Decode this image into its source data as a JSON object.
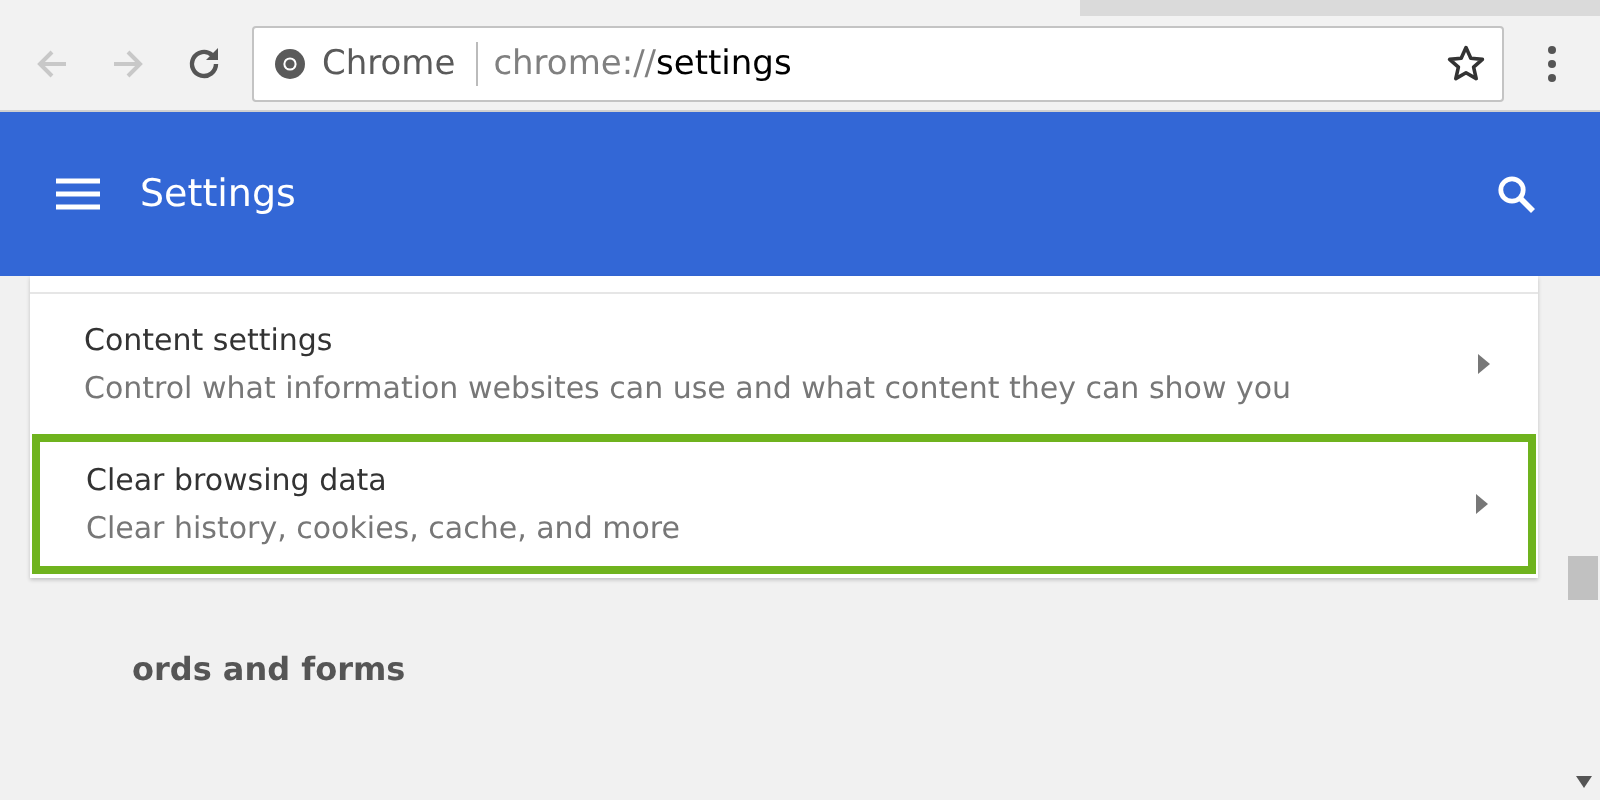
{
  "toolbar": {
    "back": {
      "disabled": true
    },
    "forward": {
      "disabled": true
    },
    "address": {
      "site_label": "Chrome",
      "url_scheme": "chrome://",
      "url_path": "settings"
    }
  },
  "header": {
    "title": "Settings"
  },
  "rows": [
    {
      "title": "Content settings",
      "description": "Control what information websites can use and what content they can show you",
      "highlighted": false
    },
    {
      "title": "Clear browsing data",
      "description": "Clear history, cookies, cache, and more",
      "highlighted": true
    }
  ],
  "section_heading": "ords and forms"
}
